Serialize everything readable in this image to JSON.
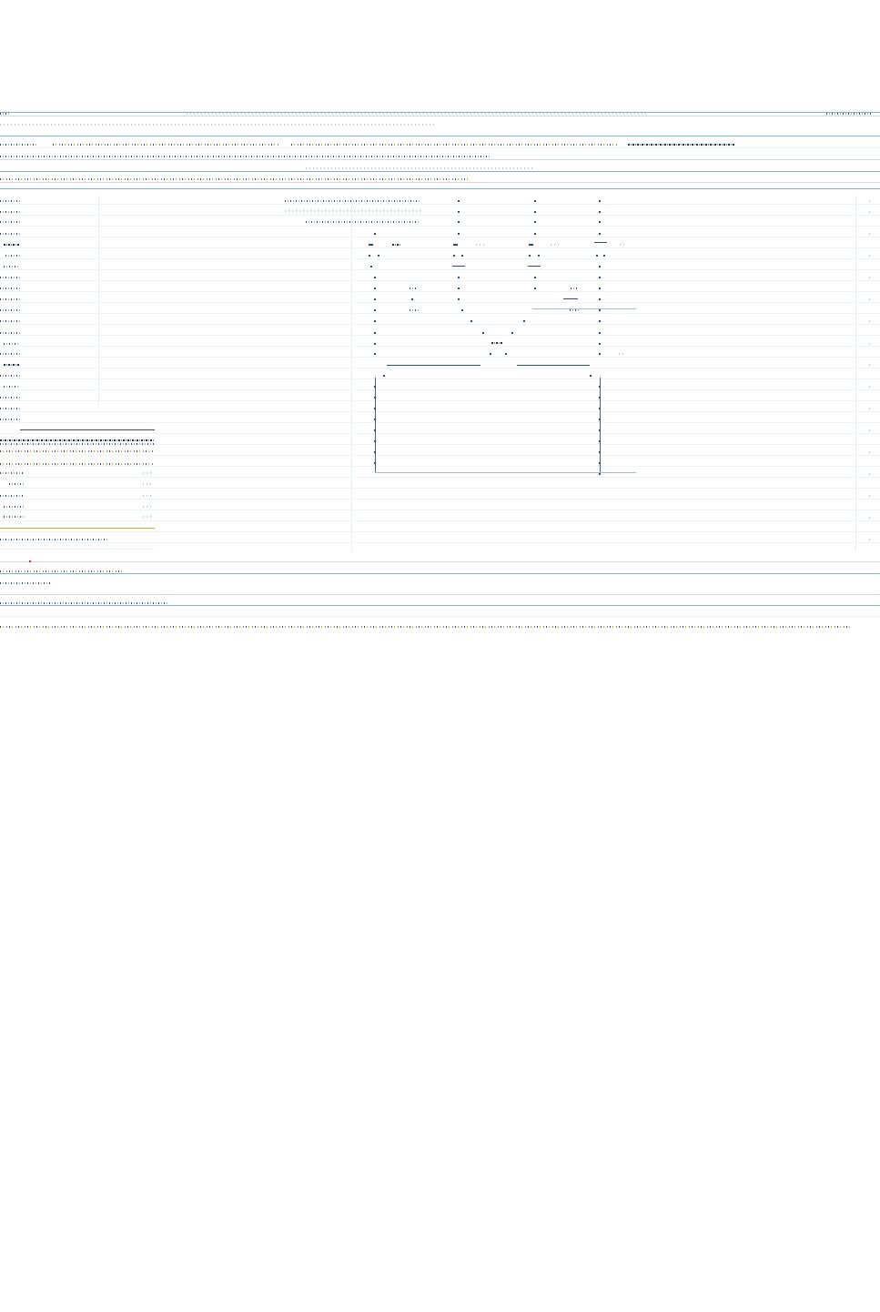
{
  "window": {
    "title": ""
  },
  "toolbar": {
    "status": ""
  },
  "colors": {
    "rule": "#7fb2c9",
    "text": "#1f3a66",
    "accent": "#e0b030",
    "flow": "#2d4a8a"
  },
  "icons": [
    "warning-marker-icon"
  ],
  "sidebar": {
    "rows": 16
  },
  "diagram": {
    "branches": 3
  }
}
